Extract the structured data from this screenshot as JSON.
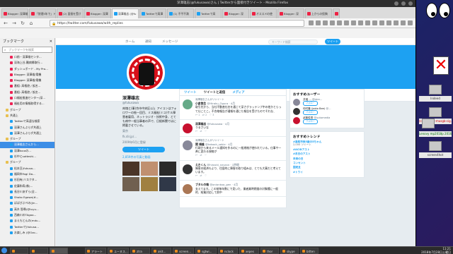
{
  "window": {
    "title": "深澤雄志(@fukusawa)さん | Twitterから面接付きツイート - Mozilla Firefox"
  },
  "tabs": [
    {
      "label": "Blogger: 深澤雄"
    },
    {
      "label": "「禁煙5年で」ト"
    },
    {
      "label": "(2) 面接を受け"
    },
    {
      "label": "Blogger: 深澤"
    },
    {
      "label": "深澤雄志 (@fu"
    },
    {
      "label": "Twitterで高澤"
    },
    {
      "label": "(1) 不平不満"
    },
    {
      "label": "Twitterで高"
    },
    {
      "label": "Blogger: 深"
    },
    {
      "label": "オススメの使"
    },
    {
      "label": "Blogger: 深"
    },
    {
      "label": "上からの投稿"
    }
  ],
  "url": "https://twitter.com/fukusawa/with_replies",
  "sidebar": {
    "title": "ブックマーク",
    "search_placeholder": "ブックマークを検索",
    "items": [
      {
        "label": "ロ前・深澤雄センタ..."
      },
      {
        "label": "深海上谷-難病縁取行..."
      },
      {
        "label": "ダッシュボード - My Pro..."
      },
      {
        "label": "Blogger: 深澤雄/電機"
      },
      {
        "label": "Blogger: 深澤雄/電機"
      },
      {
        "label": "番組: 高格遊 / 仮名..."
      },
      {
        "label": "番組: 高格遊 / 仮名..."
      },
      {
        "label": "ロ福祉推進センター/深..."
      },
      {
        "label": "福祉用の情報取得する..."
      },
      {
        "label": "グループ"
      },
      {
        "label": "共通上"
      },
      {
        "label": "Twitterで高速な検索"
      },
      {
        "label": "深澤さんぶらず共通上"
      },
      {
        "label": "深澤さんぶらず共通上"
      },
      {
        "label": "グループ"
      },
      {
        "label": "深澤雄志さんから..."
      },
      {
        "label": "深澤tocaの..."
      },
      {
        "label": "杉中とsotteshi..."
      },
      {
        "label": "グループ"
      },
      {
        "label": "松本亘(fukusa..."
      },
      {
        "label": "福岡市Yogi Do..."
      },
      {
        "label": "杉田有(リスクタ..."
      },
      {
        "label": "佐藤和寿(株)..."
      },
      {
        "label": "長谷川あずら(全..."
      },
      {
        "label": "Shoko Egawa(#..."
      },
      {
        "label": "ぱばぴぷぺの(jin..."
      },
      {
        "label": "高木 智尋(@tuyu..."
      },
      {
        "label": "西森川のTAgoo..."
      },
      {
        "label": "まえもとんの(mdu..."
      },
      {
        "label": "Twitterで(fukusa..."
      },
      {
        "label": "お楽しみ (@Ozo..."
      }
    ]
  },
  "twitter": {
    "nav": [
      "ホーム",
      "通知",
      "メッセージ"
    ],
    "search_placeholder": "キーワード検索",
    "tweet_button": "ツイート",
    "stats": [
      {
        "label": "ツイート",
        "value": "70,962"
      },
      {
        "label": "フォロー",
        "value": "6,617"
      },
      {
        "label": "フォロワー",
        "value": "6,108"
      },
      {
        "label": "いいね",
        "value": "23,930"
      }
    ],
    "follow_button": "フォロー中",
    "profile": {
      "name": "深澤雄志",
      "handle": "@fukusawa",
      "bio": "肉塊と(事)京市中央区公)」アイコンはフォロワーの絵一回目、ミス福祉(ミコ)ケル障害者雇用、ネットラジオ・技術中身、とても病中一般当事者の声で、日経新聞ではに掲載させている。",
      "location": "東京",
      "link": "fk.dir.jp/...",
      "joined": "2009年6月に登録",
      "tweet_btn": "ツイート",
      "media_label": "2,859件の写真と動画"
    },
    "timeline_tabs": [
      "ツイート",
      "ツイートと返信",
      "メディア"
    ],
    "tweets": [
      {
        "ctx": "深澤雄志さんがリツイート",
        "who": "小倉悠生",
        "handle": "@Hiraku_Ogura · 4月",
        "text": "取引先から、当社不動産社名を通じて深さグラッテンプ中の他かとらって仕ことこ。不合格報告が通報を通じた報告を受けたのでそれな、"
      },
      {
        "ctx": "",
        "who": "深澤雄志",
        "handle": "@fukusawa · 4月",
        "text": "うるさいな"
      },
      {
        "ctx": "深澤雄志さんがリツイート",
        "who": "関 靖雄",
        "handle": "@takaoh_sekie · 4月",
        "text": "行政から来るメール通知を作るのに一般規格が使われている。仕事や一斉に変わる規格が"
      },
      {
        "ctx": "",
        "who": "えきくん",
        "handle": "@hiroshi_neuron · 1時間",
        "text": "障害の経済もより、住居的に障害の取り組みは、とても大事だと考えています。"
      },
      {
        "ctx": "",
        "who": "ブタルの魂",
        "handle": "@onionkoa_gen · 4月",
        "text": "支えてます。この前毎年数にで見いた、業者業時期度の対象種に一般的、結業対応して前中"
      }
    ],
    "who_to_follow_title": "おすすめユーザー",
    "suggestions": [
      {
        "name": "井端 ...",
        "handle": "@isbn..."
      },
      {
        "name": "仲村隆 (Jakio Bee)",
        "handle": "@..."
      },
      {
        "name": "武藤俊男",
        "handle": "@yutomedia"
      }
    ],
    "follow_label": "フォロー",
    "trends_title": "おすすめトレンド",
    "trends": [
      {
        "tag": "#高知市長5歳の5ちゃん",
        "count": "2,000 ツイート"
      },
      {
        "tag": "#ACIDアスト",
        "count": ""
      },
      {
        "tag": "#月日のアスト",
        "count": ""
      },
      {
        "tag": "未来の日",
        "count": ""
      },
      {
        "tag": "コンセント",
        "count": ""
      },
      {
        "tag": "国定旦",
        "count": ""
      },
      {
        "tag": "#トワイ",
        "count": ""
      }
    ]
  },
  "desktop": {
    "labels": [
      "Indeed",
      "(sweat-add-musgb-cig...)",
      "Lenovy mp2018p 2016(...)",
      "screen4hot"
    ]
  },
  "taskbar": {
    "items": [
      "アラート",
      "ユーヌス...",
      "ztra",
      "akit...",
      "screen...",
      "sgtwi...",
      "nclock",
      "xepes",
      "thor",
      "skype",
      "bitten"
    ],
    "time": "11:21",
    "date": "2018年7月28日土曜日"
  }
}
